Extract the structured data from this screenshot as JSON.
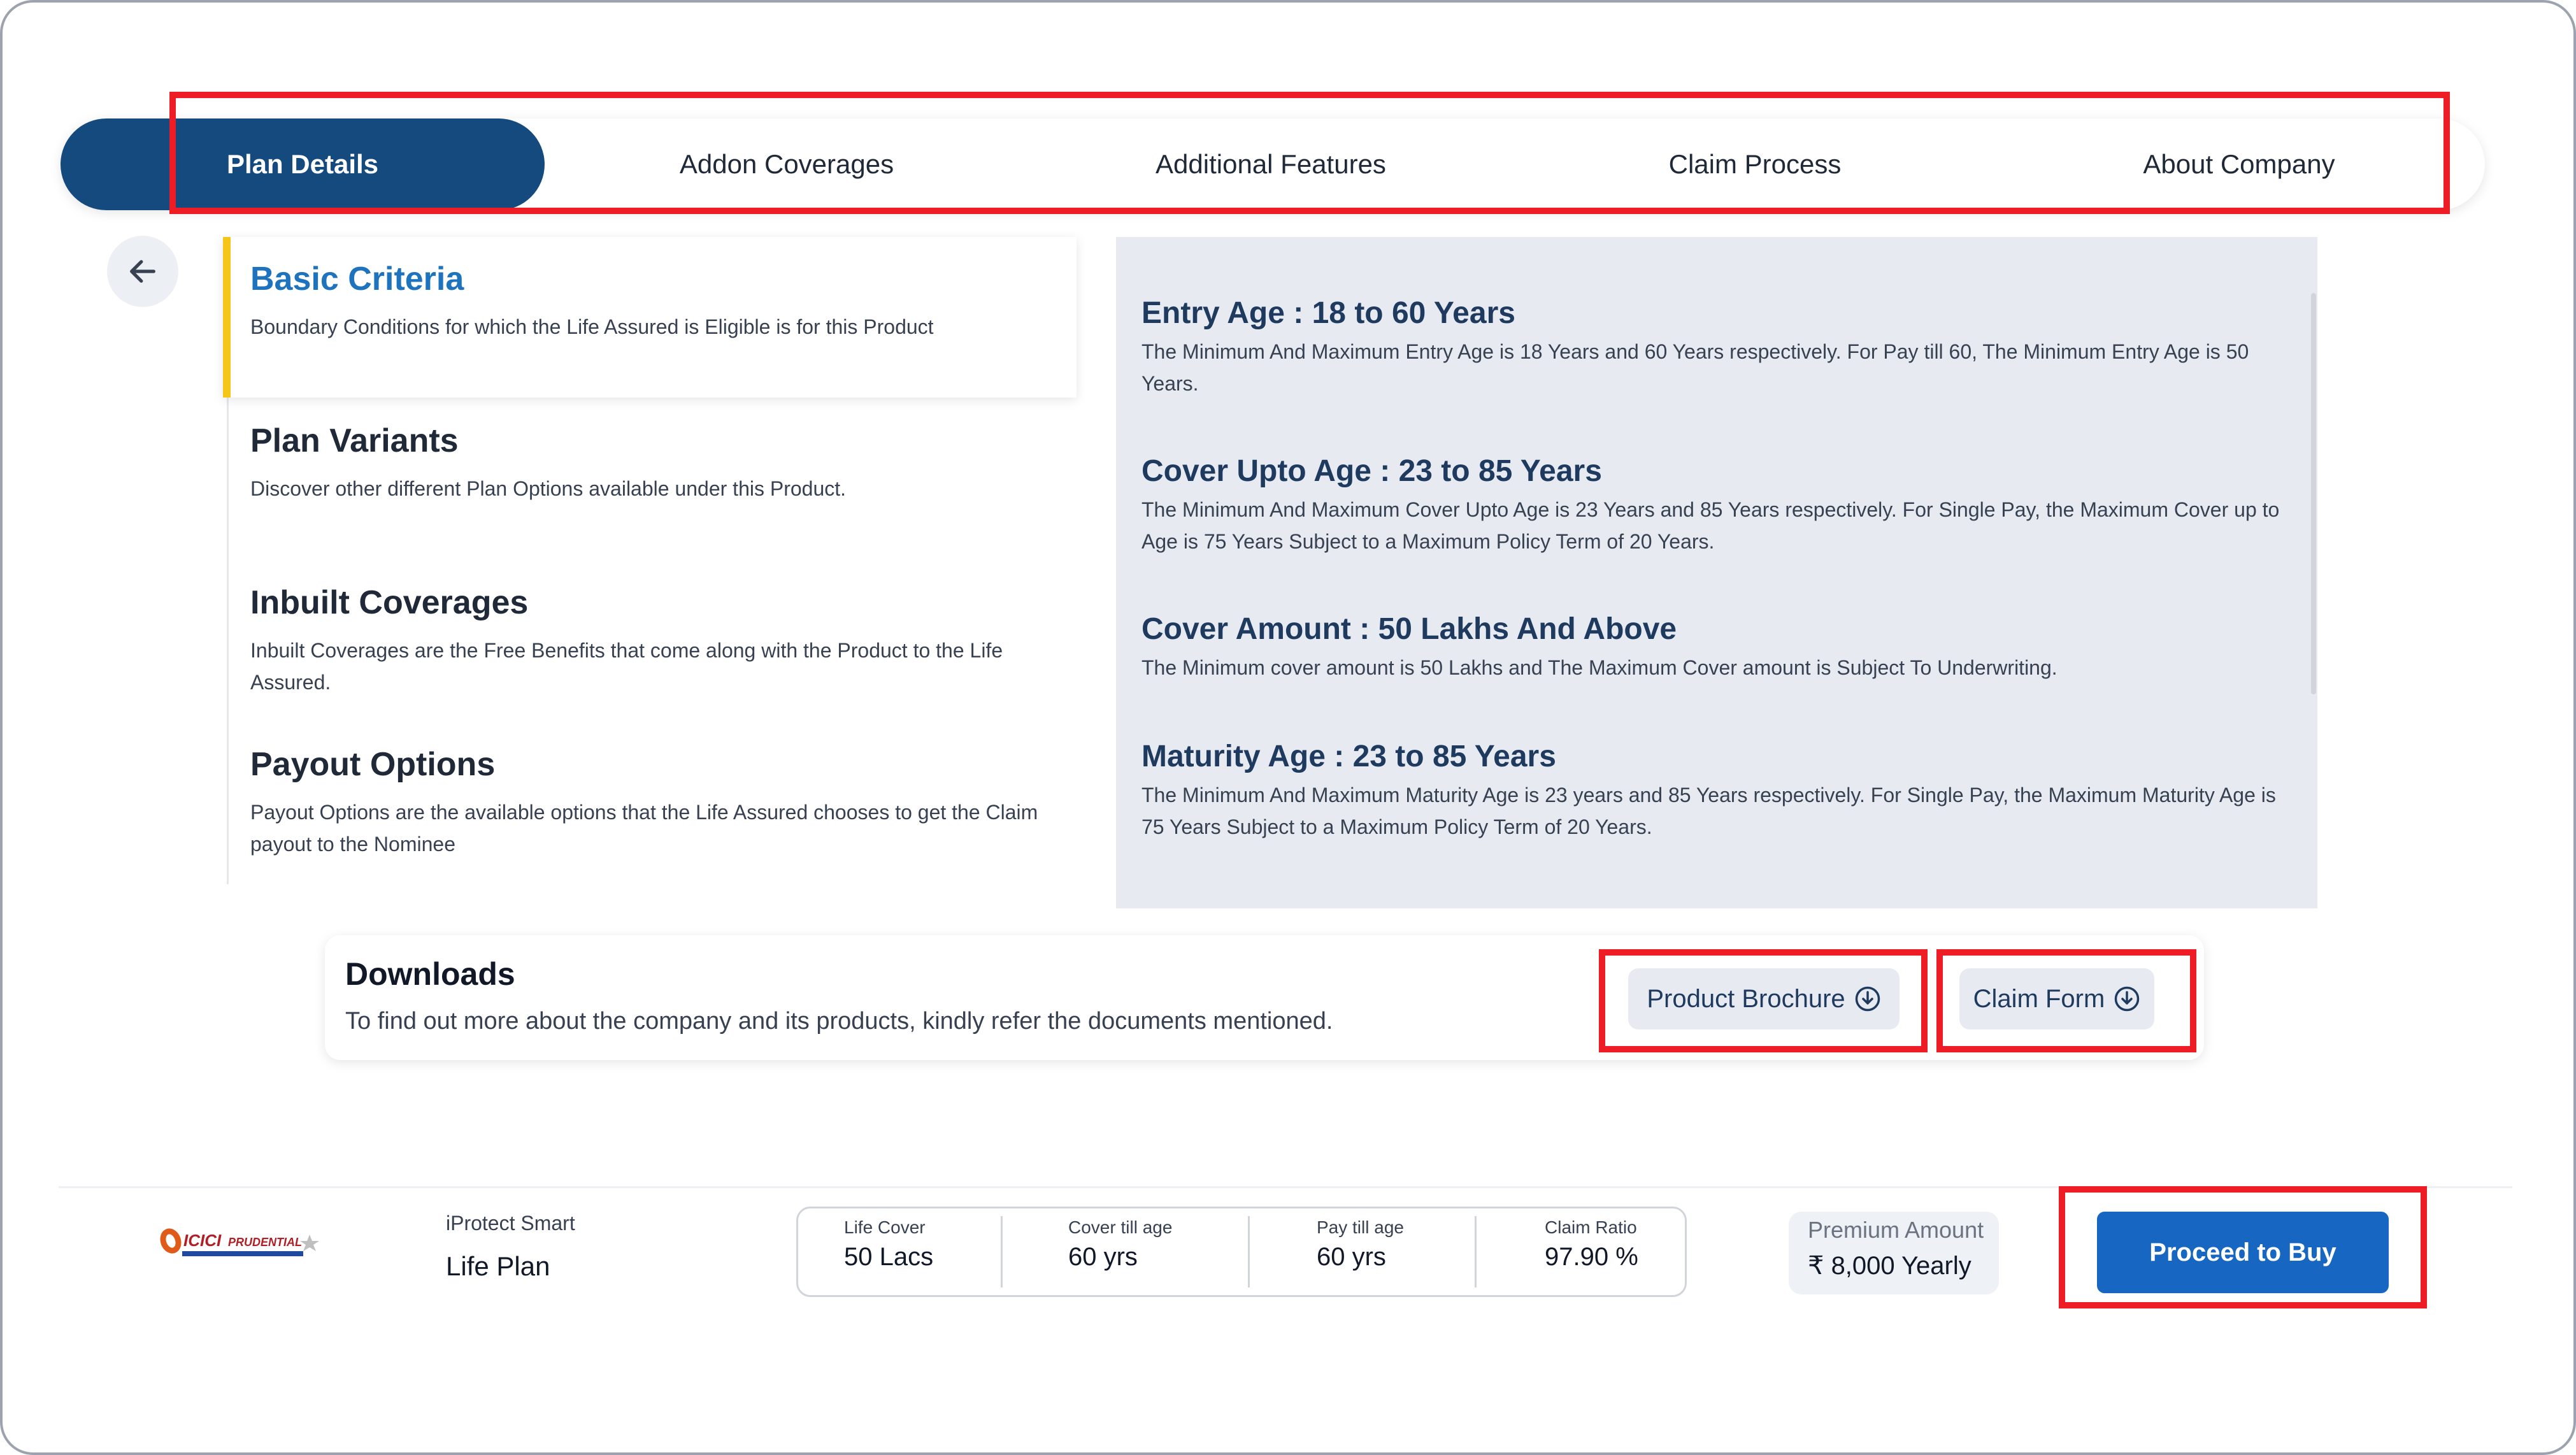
{
  "tabs": [
    {
      "label": "Plan Details",
      "active": true
    },
    {
      "label": "Addon Coverages",
      "active": false
    },
    {
      "label": "Additional Features",
      "active": false
    },
    {
      "label": "Claim Process",
      "active": false
    },
    {
      "label": "About Company",
      "active": false
    }
  ],
  "left_menu": [
    {
      "title": "Basic Criteria",
      "desc": "Boundary Conditions for which the Life Assured is Eligible is for this Product",
      "active": true
    },
    {
      "title": "Plan Variants",
      "desc": "Discover other different Plan Options available under this Product."
    },
    {
      "title": "Inbuilt Coverages",
      "desc": "Inbuilt Coverages are the Free Benefits that come along with the Product to the Life Assured."
    },
    {
      "title": "Payout Options",
      "desc": "Payout Options are the available options that the Life Assured chooses to get the Claim payout to the Nominee"
    }
  ],
  "criteria": [
    {
      "heading": "Entry Age : 18 to 60 Years",
      "text": "The Minimum And Maximum Entry Age is 18 Years and 60 Years respectively. For Pay till 60, The Minimum Entry Age is 50 Years."
    },
    {
      "heading": "Cover Upto Age : 23 to 85 Years",
      "text": "The Minimum And Maximum Cover Upto Age is 23 Years and 85 Years respectively. For Single Pay, the Maximum Cover up to Age is 75 Years Subject to a Maximum Policy Term of 20 Years."
    },
    {
      "heading": "Cover Amount : 50 Lakhs And Above",
      "text": "The Minimum cover amount is 50 Lakhs and The Maximum Cover amount is Subject To Underwriting."
    },
    {
      "heading": "Maturity Age : 23 to 85 Years",
      "text": "The Minimum And Maximum Maturity Age is 23 years and 85 Years respectively. For Single Pay, the Maximum Maturity Age is 75 Years Subject to a Maximum Policy Term of 20 Years."
    }
  ],
  "downloads": {
    "title": "Downloads",
    "desc": "To find out more about the company and its products, kindly refer the documents mentioned.",
    "brochure_label": "Product Brochure",
    "claim_label": "Claim Form"
  },
  "footer": {
    "insurer_logo_text": "ICICI PRUDENTIAL",
    "plan_sub": "iProtect Smart",
    "plan_name": "Life Plan",
    "stats": [
      {
        "label": "Life Cover",
        "value": "50 Lacs"
      },
      {
        "label": "Cover till age",
        "value": "60 yrs"
      },
      {
        "label": "Pay till age",
        "value": "60 yrs"
      },
      {
        "label": "Claim Ratio",
        "value": "97.90 %"
      }
    ],
    "premium_label": "Premium Amount",
    "premium_value": "₹ 8,000 Yearly",
    "buy_label": "Proceed to Buy"
  },
  "colors": {
    "primary": "#154a7e",
    "button": "#1767c2",
    "highlight": "#ee1c25",
    "accent_bar": "#f5c518"
  }
}
